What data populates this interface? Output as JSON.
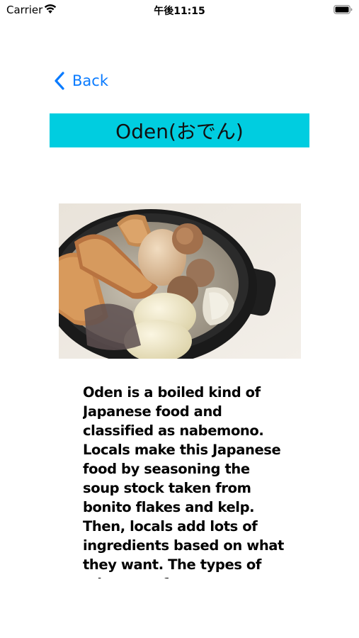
{
  "status_bar": {
    "carrier": "Carrier",
    "time": "午後11:15",
    "wifi_icon": "wifi-icon",
    "battery_icon": "battery-icon"
  },
  "nav": {
    "back_label": "Back",
    "back_icon": "chevron-left-icon",
    "accent_color": "#0a7bff"
  },
  "header": {
    "title": "Oden(おでん)",
    "background_color": "#00cde0"
  },
  "photo": {
    "subject": "oden-dish-photo"
  },
  "description": {
    "text": "Oden is a boiled kind of Japanese food and classified as nabemono. Locals make this Japanese food by seasoning the soup stock taken from bonito flakes and kelp. Then, locals add lots of ingredients based on what they want. The types of oden vary from"
  }
}
